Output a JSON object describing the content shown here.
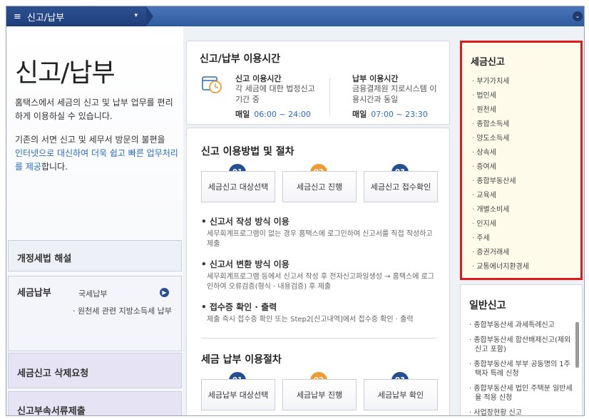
{
  "topbar": {
    "menu_label": "신고/납부",
    "hamburger": "≡",
    "caret": "▾",
    "circle_icon": "chevron-down-icon"
  },
  "left": {
    "title": "신고/납부",
    "intro": "홈택스에서 세금의 신고 및 납부 업무를 편리하게 이용하실 수 있습니다.",
    "intro2_plain_1": "기존의 서면 신고 및 세무서 방문의 불편을",
    "intro2_link": "인터넷으로 대신하여 더욱 쉽고 빠른 업무처리를 제공",
    "intro2_plain_2": "합니다.",
    "boxes": [
      {
        "label": "개정세법 해설"
      },
      {
        "label": "세금납부",
        "sub1": "국세납부",
        "sub2": "· 원천세 관련 지방소득세 납부"
      },
      {
        "label": "세금신고 삭제요청"
      },
      {
        "label": "신고부속서류제출"
      }
    ]
  },
  "usage": {
    "title": "신고/납부 이용시간",
    "report": {
      "title": "신고 이용시간",
      "desc": "각 세금에 대한 법정신고 기간 중",
      "day": "매일",
      "time": "06:00 ~ 24:00"
    },
    "pay": {
      "title": "납부 이용시간",
      "desc": "금융결제원 지로시스템 이용시간과 동일",
      "day": "매일",
      "time": "07:00 ~ 23:30"
    }
  },
  "procedure": {
    "title": "신고 이용방법 및 절차",
    "steps": [
      {
        "num": "01",
        "label": "세금신고 대상선택"
      },
      {
        "num": "02",
        "label": "세금신고 진행"
      },
      {
        "num": "03",
        "label": "세금신고 접수확인"
      }
    ],
    "bullets": [
      {
        "head": "• 신고서 작성 방식 이용",
        "desc": "세무회계프로그램이 없는 경우 홈택스에 로그인하여 신고서를 직접 작성하고 제출"
      },
      {
        "head": "• 신고서 변환 방식 이용",
        "desc": "세무회계프로그램 등에서 신고서 작성 후 전자신고파일생성 → 홈택스에 로그인하여 오류검증(형식 · 내용검증) 후 제출"
      },
      {
        "head": "• 접수증 확인 · 출력",
        "desc": "제출 즉시 접수증 확인 또는 Step2[신고내역]에서 접수증 확인 · 출력"
      }
    ],
    "pay_title": "세금 납부 이용절차",
    "pay_steps": [
      {
        "num": "01",
        "label": "세금납부 대상선택"
      },
      {
        "num": "02",
        "label": "세금납부 진행"
      },
      {
        "num": "03",
        "label": "세금납부 확인"
      }
    ]
  },
  "tax_report": {
    "title": "세금신고",
    "items": [
      "부가가치세",
      "법인세",
      "원천세",
      "종합소득세",
      "양도소득세",
      "상속세",
      "증여세",
      "종합부동산세",
      "교육세",
      "개별소비세",
      "인지세",
      "주세",
      "증권거래세",
      "교통에너지환경세"
    ]
  },
  "general_report": {
    "title": "일반신고",
    "items": [
      "종합부동산세 과세특례신고",
      "종합부동산세 합산배제신고(제외 신고 포함)",
      "종합부동산세 부부 공동명의 1주택자 특례 신청",
      "종합부동산세 법인 주택분 일반세율 적용 신청",
      "사업장현황 신고"
    ]
  },
  "colors": {
    "accent": "#2a6cc4",
    "step_blue": "#24508f",
    "step_orange": "#ef9b34",
    "highlight": "#e0191a"
  }
}
